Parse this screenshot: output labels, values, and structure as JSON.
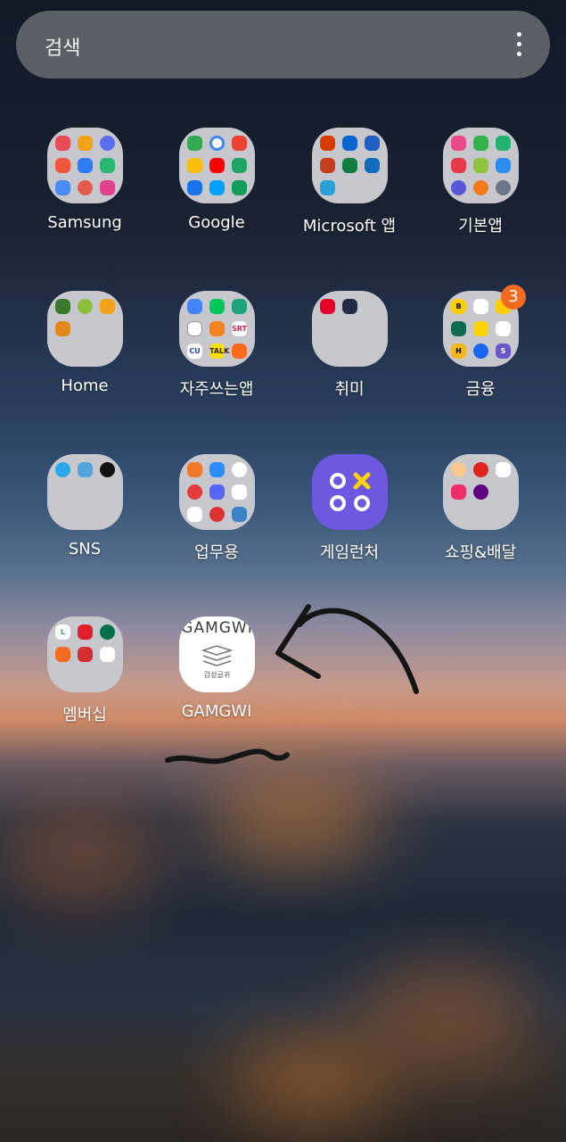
{
  "search": {
    "placeholder": "검색"
  },
  "apps": [
    {
      "label": "Samsung"
    },
    {
      "label": "Google"
    },
    {
      "label": "Microsoft 앱"
    },
    {
      "label": "기본앱"
    },
    {
      "label": "Home"
    },
    {
      "label": "자주쓰는앱"
    },
    {
      "label": "취미"
    },
    {
      "label": "금융",
      "badge": "3"
    },
    {
      "label": "SNS"
    },
    {
      "label": "업무용"
    },
    {
      "label": "게임런처"
    },
    {
      "label": "쇼핑&배달"
    },
    {
      "label": "멤버십"
    },
    {
      "label": "GAMGWI"
    }
  ],
  "gamgwi_icon": {
    "top_text": "GAMGWI",
    "sub_text": "감성글귀"
  },
  "colors": {
    "badge": "#f26b21",
    "game_launcher": "#6e57e0",
    "folder": "#c6c8ce"
  }
}
